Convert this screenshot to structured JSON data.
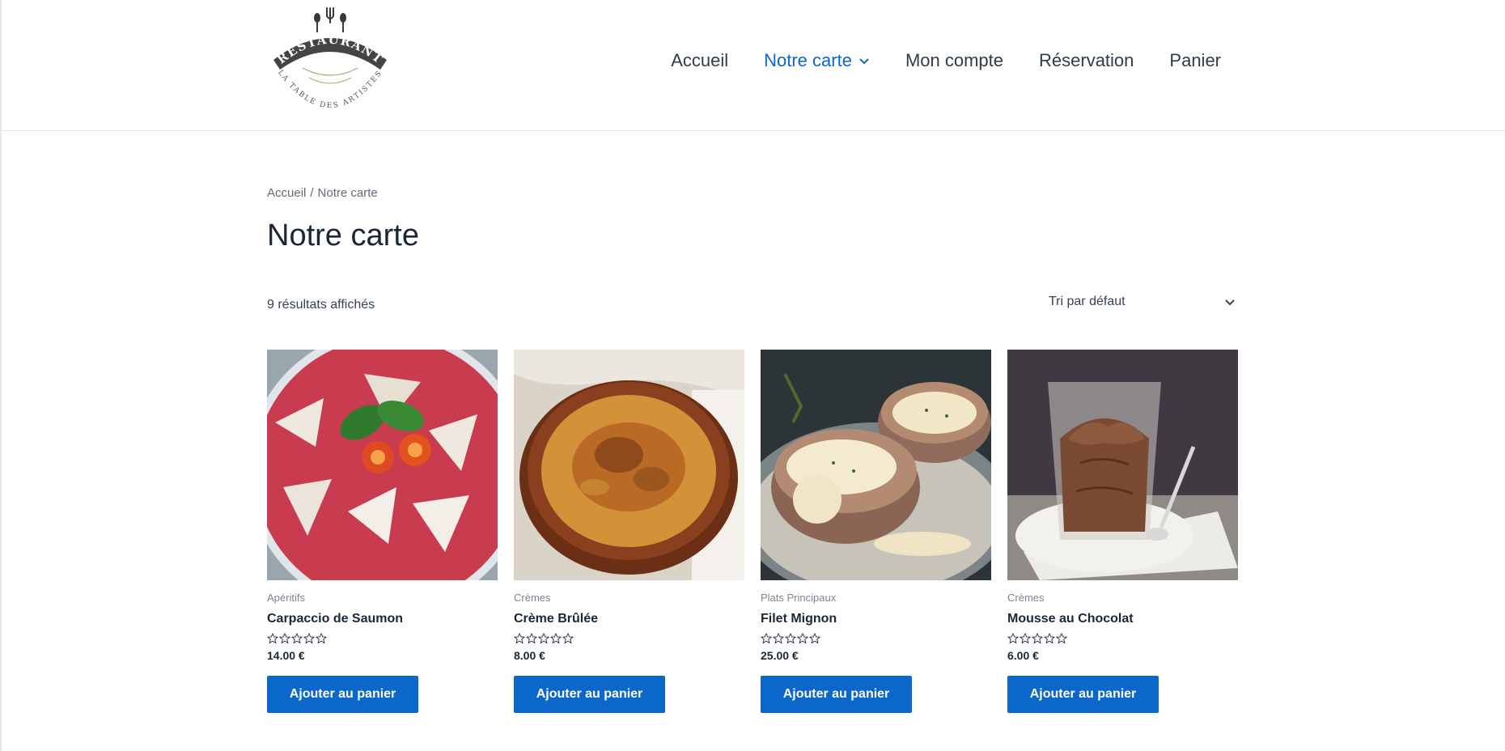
{
  "header": {
    "logo": {
      "text": "RESTAURANT",
      "subtitle": "LA TABLE DES ARTISTES"
    },
    "nav": [
      {
        "label": "Accueil"
      },
      {
        "label": "Notre carte"
      },
      {
        "label": "Mon compte"
      },
      {
        "label": "Réservation"
      },
      {
        "label": "Panier"
      }
    ],
    "active_nav": "Notre carte",
    "accent_color": "#0b67c9"
  },
  "breadcrumb": {
    "home": "Accueil",
    "separator": "/",
    "current": "Notre carte"
  },
  "page_title": "Notre carte",
  "result_count": "9 résultats affichés",
  "ordering": {
    "selected": "Tri par défaut"
  },
  "products": [
    {
      "category": "Apéritifs",
      "name": "Carpaccio de Saumon",
      "price": "14.00 €",
      "rating": 0,
      "button": "Ajouter au panier",
      "image": "carpaccio"
    },
    {
      "category": "Crèmes",
      "name": "Crème Brûlée",
      "price": "8.00 €",
      "rating": 0,
      "button": "Ajouter au panier",
      "image": "creme-brulee"
    },
    {
      "category": "Plats Principaux",
      "name": "Filet Mignon",
      "price": "25.00 €",
      "rating": 0,
      "button": "Ajouter au panier",
      "image": "filet-mignon"
    },
    {
      "category": "Crèmes",
      "name": "Mousse au Chocolat",
      "price": "6.00 €",
      "rating": 0,
      "button": "Ajouter au panier",
      "image": "mousse-chocolat"
    }
  ]
}
